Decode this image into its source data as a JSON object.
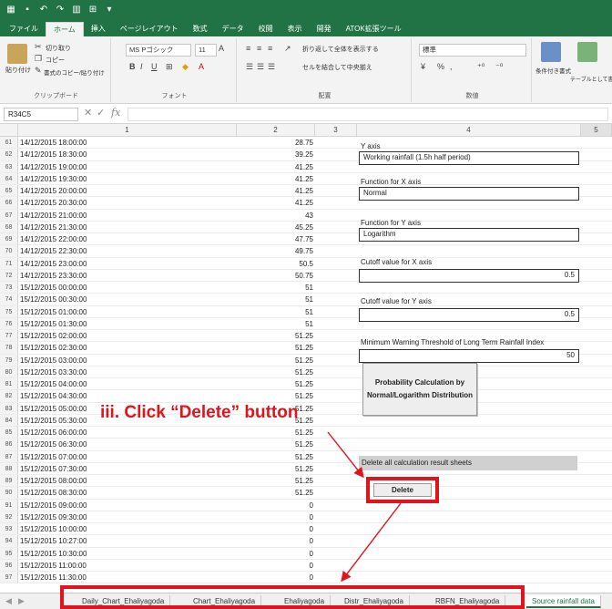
{
  "tabs": [
    "ファイル",
    "ホーム",
    "挿入",
    "ページレイアウト",
    "数式",
    "データ",
    "校閲",
    "表示",
    "開発",
    "ATOK拡張ツール"
  ],
  "active_tab_index": 1,
  "ribbon": {
    "clipboard": {
      "paste": "貼り付け",
      "cut": "切り取り",
      "copy": "コピー",
      "format_painter": "書式のコピー/貼り付け",
      "group": "クリップボード"
    },
    "font": {
      "name": "MS Pゴシック",
      "size": "11",
      "group": "フォント"
    },
    "alignment": {
      "wrap": "折り返して全体を表示する",
      "merge": "セルを結合して中央揃え",
      "group": "配置"
    },
    "number": {
      "format": "標準",
      "group": "数値"
    },
    "styles": {
      "conditional": "条件付き書式",
      "table": "テーブルとして書式設定"
    }
  },
  "formula_bar": {
    "name_box": "R34C5",
    "formula": ""
  },
  "columns": [
    "1",
    "2",
    "3",
    "4",
    "5"
  ],
  "rows": [
    {
      "n": "61",
      "date": "14/12/2015 18:00:00",
      "value": "28.75"
    },
    {
      "n": "62",
      "date": "14/12/2015 18:30:00",
      "value": "39.25"
    },
    {
      "n": "63",
      "date": "14/12/2015 19:00:00",
      "value": "41.25"
    },
    {
      "n": "64",
      "date": "14/12/2015 19:30:00",
      "value": "41.25"
    },
    {
      "n": "65",
      "date": "14/12/2015 20:00:00",
      "value": "41.25"
    },
    {
      "n": "66",
      "date": "14/12/2015 20:30:00",
      "value": "41.25"
    },
    {
      "n": "67",
      "date": "14/12/2015 21:00:00",
      "value": "43"
    },
    {
      "n": "68",
      "date": "14/12/2015 21:30:00",
      "value": "45.25"
    },
    {
      "n": "69",
      "date": "14/12/2015 22:00:00",
      "value": "47.75"
    },
    {
      "n": "70",
      "date": "14/12/2015 22:30:00",
      "value": "49.75"
    },
    {
      "n": "71",
      "date": "14/12/2015 23:00:00",
      "value": "50.5"
    },
    {
      "n": "72",
      "date": "14/12/2015 23:30:00",
      "value": "50.75"
    },
    {
      "n": "73",
      "date": "15/12/2015 00:00:00",
      "value": "51"
    },
    {
      "n": "74",
      "date": "15/12/2015 00:30:00",
      "value": "51"
    },
    {
      "n": "75",
      "date": "15/12/2015 01:00:00",
      "value": "51"
    },
    {
      "n": "76",
      "date": "15/12/2015 01:30:00",
      "value": "51"
    },
    {
      "n": "77",
      "date": "15/12/2015 02:00:00",
      "value": "51.25"
    },
    {
      "n": "78",
      "date": "15/12/2015 02:30:00",
      "value": "51.25"
    },
    {
      "n": "79",
      "date": "15/12/2015 03:00:00",
      "value": "51.25"
    },
    {
      "n": "80",
      "date": "15/12/2015 03:30:00",
      "value": "51.25"
    },
    {
      "n": "81",
      "date": "15/12/2015 04:00:00",
      "value": "51.25"
    },
    {
      "n": "82",
      "date": "15/12/2015 04:30:00",
      "value": "51.25"
    },
    {
      "n": "83",
      "date": "15/12/2015 05:00:00",
      "value": "51.25"
    },
    {
      "n": "84",
      "date": "15/12/2015 05:30:00",
      "value": "51.25"
    },
    {
      "n": "85",
      "date": "15/12/2015 06:00:00",
      "value": "51.25"
    },
    {
      "n": "86",
      "date": "15/12/2015 06:30:00",
      "value": "51.25"
    },
    {
      "n": "87",
      "date": "15/12/2015 07:00:00",
      "value": "51.25"
    },
    {
      "n": "88",
      "date": "15/12/2015 07:30:00",
      "value": "51.25"
    },
    {
      "n": "89",
      "date": "15/12/2015 08:00:00",
      "value": "51.25"
    },
    {
      "n": "90",
      "date": "15/12/2015 08:30:00",
      "value": "51.25"
    },
    {
      "n": "91",
      "date": "15/12/2015 09:00:00",
      "value": "0"
    },
    {
      "n": "92",
      "date": "15/12/2015 09:30:00",
      "value": "0"
    },
    {
      "n": "93",
      "date": "15/12/2015 10:00:00",
      "value": "0"
    },
    {
      "n": "94",
      "date": "15/12/2015 10:27:00",
      "value": "0"
    },
    {
      "n": "95",
      "date": "15/12/2015 10:30:00",
      "value": "0"
    },
    {
      "n": "96",
      "date": "15/12/2015 11:00:00",
      "value": "0"
    },
    {
      "n": "97",
      "date": "15/12/2015 11:30:00",
      "value": "0"
    }
  ],
  "panel": {
    "y_axis_label": "Y axis",
    "y_axis_value": "Working rainfall (1.5h half period)",
    "fx_label": "Function for X axis",
    "fx_value": "Normal",
    "fy_label": "Function for Y axis",
    "fy_value": "Logarithm",
    "cx_label": "Cutoff value for X axis",
    "cx_value": "0.5",
    "cy_label": "Cutoff value for Y axis",
    "cy_value": "0.5",
    "mw_label": "Minimum Warning Threshold of Long Term Rainfall Index",
    "mw_value": "50",
    "calc_button_line1": "Probability Calculation by",
    "calc_button_line2": "Normal/Logarithm Distribution",
    "delete_label": "Delete all calculation result sheets",
    "delete_button": "Delete"
  },
  "annotation": "iii. Click “Delete” button",
  "sheet_tabs": [
    "Daily_Chart_Ehaliyagoda",
    "Chart_Ehaliyagoda",
    "Ehaliyagoda",
    "Distr_Ehaliyagoda",
    "RBFN_Ehaliyagoda",
    "Source rainfall data"
  ],
  "active_sheet_index": 5,
  "colors": {
    "excel_green": "#217346",
    "highlight_red": "#e0141c"
  }
}
